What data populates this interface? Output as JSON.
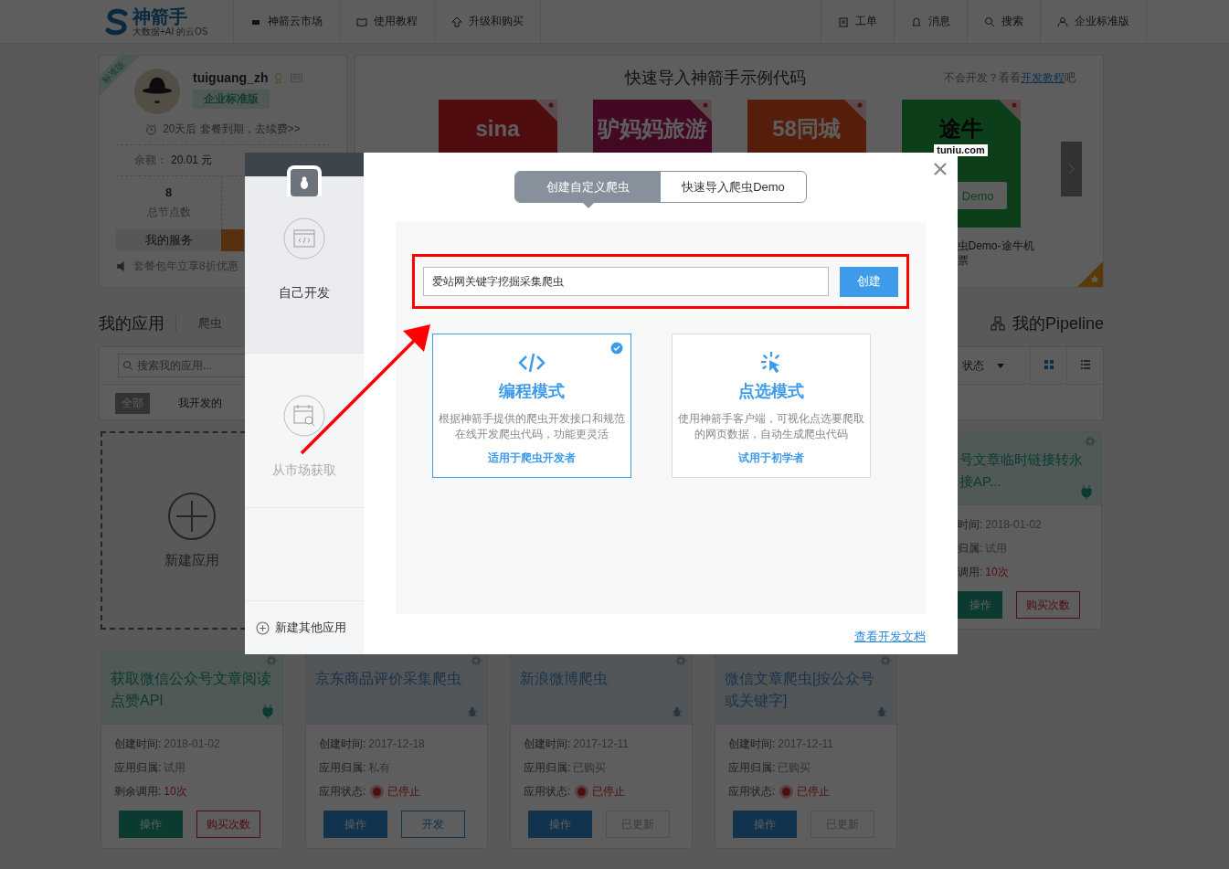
{
  "topbar": {
    "logo": {
      "name": "神箭手",
      "tagline": "大数据+AI 的云OS"
    },
    "nav": [
      {
        "label": "神箭云市场"
      },
      {
        "label": "使用教程"
      },
      {
        "label": "升级和购买"
      }
    ],
    "right": [
      {
        "label": "工单"
      },
      {
        "label": "消息"
      },
      {
        "label": "搜索"
      },
      {
        "label": "企业标准版"
      }
    ]
  },
  "profile": {
    "ribbon": "标准版",
    "username": "tuiguang_zh",
    "badge": "企业标准版",
    "expiry": "20天后 套餐到期，去续费>>",
    "balance_label": "余额：",
    "balance": "20.01 元",
    "nodes": "8",
    "nodes_label": "总节点数",
    "service": "我的服务",
    "promo": "套餐包年立享8折优惠"
  },
  "showcase": {
    "title": "快速导入神箭手示例代码",
    "help": "不会开发？看看",
    "help_link": "开发教程",
    "help_end": "吧",
    "tiles": [
      {
        "logo": "sina"
      },
      {
        "logo": "驴妈妈旅游"
      },
      {
        "logo": "58同城"
      },
      {
        "logo": "途牛",
        "sub": "tuniu.com",
        "demo": "Demo",
        "caption": "虫Demo-途牛机票"
      }
    ]
  },
  "apps": {
    "title": "我的应用",
    "tab": "爬虫",
    "pipeline": "我的Pipeline",
    "search_placeholder": "搜索我的应用...",
    "status_filter": "状态",
    "views": [
      {
        "kind": "grid",
        "selected": true
      },
      {
        "kind": "list",
        "selected": false
      }
    ],
    "filters": [
      {
        "label": "全部",
        "selected": true
      },
      {
        "label": "我开发的",
        "selected": false
      }
    ],
    "new_app": "新建应用",
    "partial_card": {
      "kind": "api",
      "title_lines": [
        "号文章临时链接转永",
        "接AP..."
      ],
      "info": [
        {
          "label": "时间:",
          "value": "2018-01-02",
          "kind": "plain"
        },
        {
          "label": "归属:",
          "value": "试用",
          "kind": "plain"
        },
        {
          "label": "调用:",
          "value": "10次",
          "kind": "count"
        }
      ],
      "buttons": [
        {
          "label": "操作",
          "kind": "primary"
        },
        {
          "label": "购买次数",
          "kind": "danger"
        }
      ]
    },
    "cards": [
      {
        "kind": "api",
        "title": "获取微信公众号文章阅读点赞API",
        "info": [
          {
            "label": "创建时间:",
            "value": "2018-01-02",
            "kind": "plain"
          },
          {
            "label": "应用归属:",
            "value": "试用",
            "kind": "plain"
          },
          {
            "label": "剩余调用:",
            "value": "10次",
            "kind": "count"
          }
        ],
        "buttons": [
          {
            "label": "操作",
            "kind": "primary"
          },
          {
            "label": "购买次数",
            "kind": "danger"
          }
        ]
      },
      {
        "kind": "crawler",
        "title": "京东商品评价采集爬虫",
        "info": [
          {
            "label": "创建时间:",
            "value": "2017-12-18",
            "kind": "plain"
          },
          {
            "label": "应用归属:",
            "value": "私有",
            "kind": "plain"
          },
          {
            "label": "应用状态:",
            "value": "已停止",
            "kind": "status"
          }
        ],
        "buttons": [
          {
            "label": "操作",
            "kind": "primary"
          },
          {
            "label": "开发",
            "kind": "outline"
          }
        ]
      },
      {
        "kind": "crawler",
        "title": "新浪微博爬虫",
        "info": [
          {
            "label": "创建时间:",
            "value": "2017-12-11",
            "kind": "plain"
          },
          {
            "label": "应用归属:",
            "value": "已购买",
            "kind": "plain"
          },
          {
            "label": "应用状态:",
            "value": "已停止",
            "kind": "status"
          }
        ],
        "buttons": [
          {
            "label": "操作",
            "kind": "primary"
          },
          {
            "label": "已更新",
            "kind": "disabled"
          }
        ]
      },
      {
        "kind": "crawler",
        "title": "微信文章爬虫[按公众号或关键字]",
        "info": [
          {
            "label": "创建时间:",
            "value": "2017-12-11",
            "kind": "plain"
          },
          {
            "label": "应用归属:",
            "value": "已购买",
            "kind": "plain"
          },
          {
            "label": "应用状态:",
            "value": "已停止",
            "kind": "status"
          }
        ],
        "buttons": [
          {
            "label": "操作",
            "kind": "primary"
          },
          {
            "label": "已更新",
            "kind": "disabled"
          }
        ]
      }
    ]
  },
  "modal": {
    "sidebar": [
      {
        "label": "自己开发",
        "selected": true
      },
      {
        "label": "从市场获取",
        "selected": false
      }
    ],
    "new_other": "新建其他应用",
    "tabs": [
      {
        "label": "创建自定义爬虫",
        "selected": true
      },
      {
        "label": "快速导入爬虫Demo",
        "selected": false
      }
    ],
    "name_value": "爱站网关键字挖掘采集爬虫",
    "create": "创建",
    "modes": [
      {
        "kind": "code",
        "title": "编程模式",
        "desc": "根据神箭手提供的爬虫开发接口和规范在线开发爬虫代码，功能更灵活",
        "audience": "适用于爬虫开发者",
        "selected": true
      },
      {
        "kind": "click",
        "title": "点选模式",
        "desc": "使用神箭手客户端，可视化点选要爬取的网页数据，自动生成爬虫代码",
        "audience": "试用于初学者",
        "selected": false
      }
    ],
    "doc_link": "查看开发文档"
  }
}
